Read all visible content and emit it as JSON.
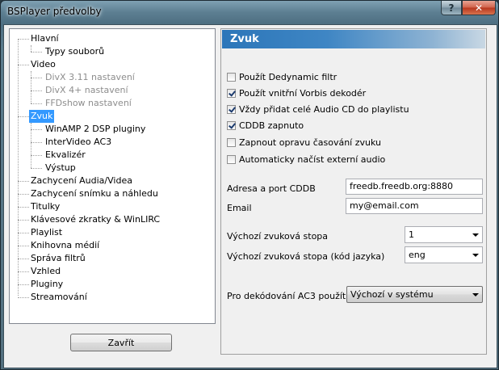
{
  "window": {
    "title": "BSPlayer předvolby"
  },
  "tree": {
    "items": [
      {
        "label": "Hlavní"
      },
      {
        "label": "Typy souborů"
      },
      {
        "label": "Video"
      },
      {
        "label": "DivX 3.11 nastavení"
      },
      {
        "label": "DivX 4+ nastavení"
      },
      {
        "label": "FFDshow nastavení"
      },
      {
        "label": "Zvuk"
      },
      {
        "label": "WinAMP 2 DSP pluginy"
      },
      {
        "label": "InterVideo AC3"
      },
      {
        "label": "Ekvalizér"
      },
      {
        "label": "Výstup"
      },
      {
        "label": "Zachycení Audia/Videa"
      },
      {
        "label": "Zachycení snímku a náhledu"
      },
      {
        "label": "Titulky"
      },
      {
        "label": "Klávesové zkratky & WinLIRC"
      },
      {
        "label": "Playlist"
      },
      {
        "label": "Knihovna médií"
      },
      {
        "label": "Správa filtrů"
      },
      {
        "label": "Vzhled"
      },
      {
        "label": "Pluginy"
      },
      {
        "label": "Streamování"
      }
    ]
  },
  "footer": {
    "close_label": "Zavřít"
  },
  "panel": {
    "title": "Zvuk",
    "checkboxes": [
      {
        "label": "Použít Dedynamic filtr",
        "checked": false
      },
      {
        "label": "Použít vnitřní Vorbis dekodér",
        "checked": true
      },
      {
        "label": "Vždy přidat celé Audio CD do playlistu",
        "checked": true
      },
      {
        "label": "CDDB zapnuto",
        "checked": true
      },
      {
        "label": "Zapnout opravu časování zvuku",
        "checked": false
      },
      {
        "label": "Automaticky načíst externí audio",
        "checked": false
      }
    ],
    "cddb": {
      "label": "Adresa a port CDDB",
      "value": "freedb.freedb.org:8880"
    },
    "email": {
      "label": "Email",
      "value": "my@email.com"
    },
    "default_stream": {
      "label": "Výchozí zvuková stopa",
      "value": "1"
    },
    "default_stream_lang": {
      "label": "Výchozí zvuková stopa (kód jazyka)",
      "value": "eng"
    },
    "ac3": {
      "label": "Pro dekódování AC3 použít",
      "value": "Výchozí v systému"
    }
  }
}
